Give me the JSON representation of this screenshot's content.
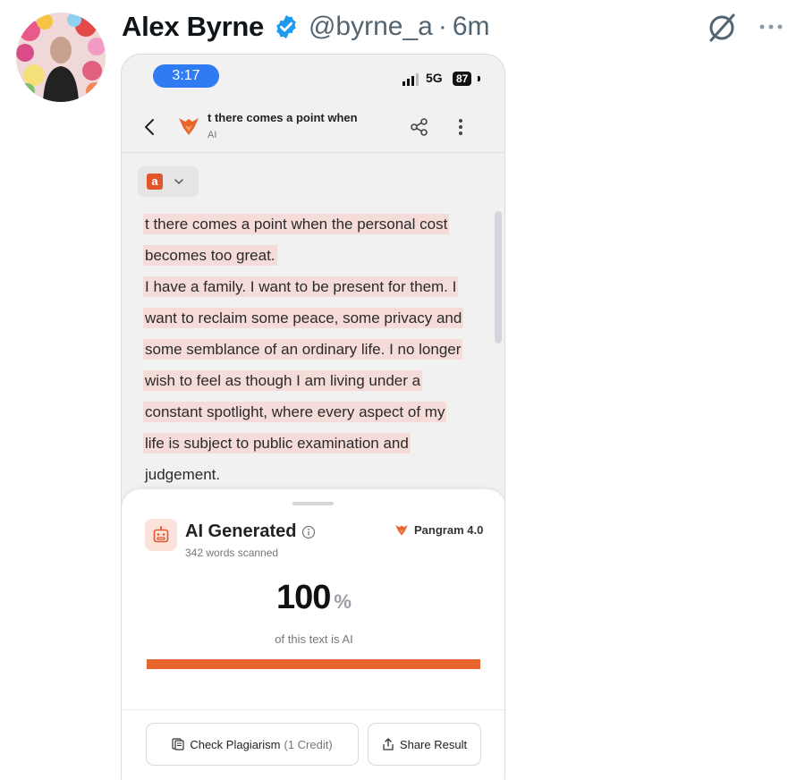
{
  "tweet": {
    "display_name": "Alex Byrne",
    "handle": "@byrne_a",
    "separator": "·",
    "time": "6m"
  },
  "phone": {
    "status": {
      "time": "3:17",
      "network": "5G",
      "battery": "87"
    },
    "app_bar": {
      "title": "t there comes a point when",
      "subtitle": "AI"
    },
    "language_badge": "a",
    "document_lines": [
      "t there comes a point when the personal cost",
      "becomes too great.",
      "I have a family. I want to be present for them. I",
      "want to reclaim some peace, some privacy and",
      "some semblance of an ordinary life. I no longer",
      "wish to feel as though I am living under a",
      "constant spotlight, where every aspect of my",
      "life is subject to public examination and",
      "judgement."
    ],
    "result": {
      "title": "AI Generated",
      "words_scanned": "342 words scanned",
      "brand": "Pangram 4.0",
      "score": "100",
      "score_unit": "%",
      "score_caption": "of this text is AI",
      "ai_fraction": 1.0,
      "check_plagiarism_label": "Check Plagiarism",
      "check_plagiarism_credit": "(1 Credit)",
      "share_label": "Share Result"
    }
  },
  "colors": {
    "accent": "#e8642d",
    "verified": "#1d9bf0",
    "highlight": "#f5dcd8",
    "time_pill": "#2f7bf2"
  }
}
